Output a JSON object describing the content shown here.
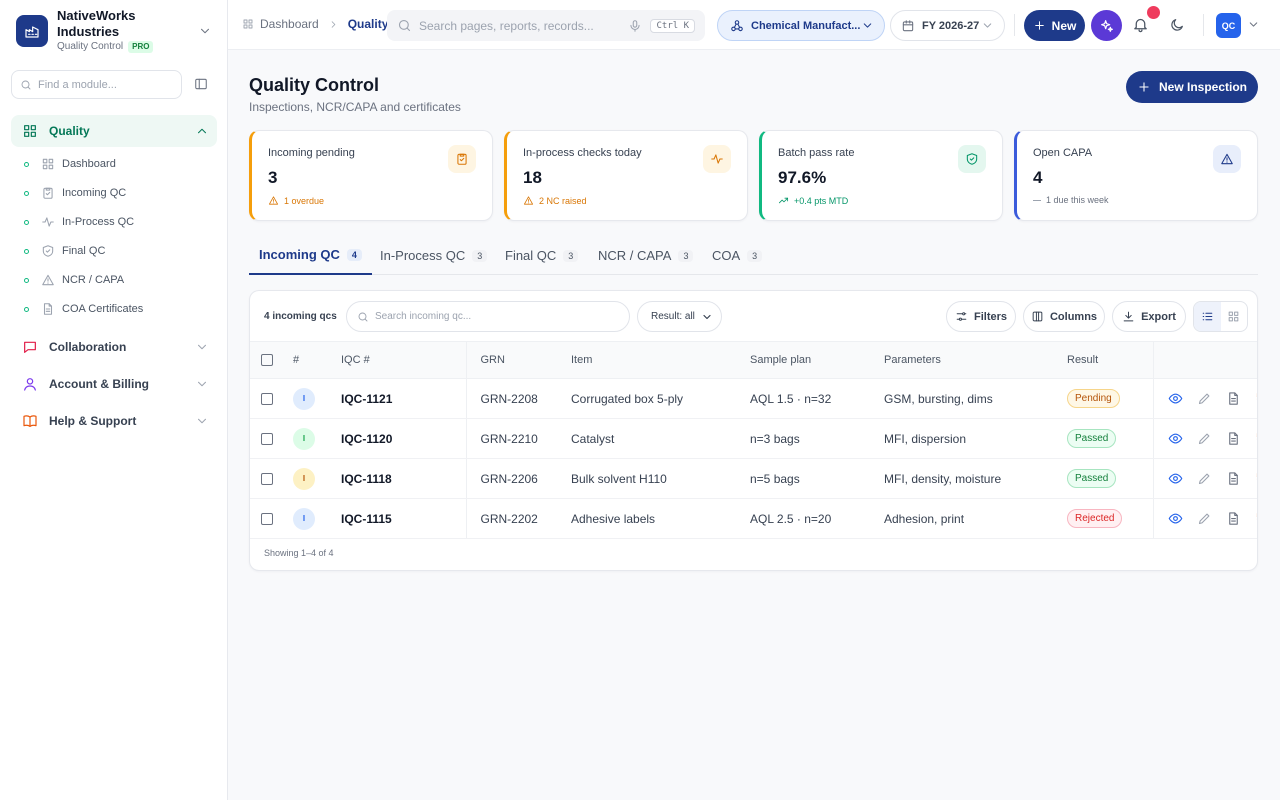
{
  "org": {
    "name": "NativeWorks Industries",
    "module": "Quality Control",
    "badge": "PRO"
  },
  "sidebar": {
    "search_placeholder": "Find a module...",
    "groups": {
      "quality": "Quality",
      "collaboration": "Collaboration",
      "account": "Account & Billing",
      "help": "Help & Support"
    },
    "quality_items": [
      "Dashboard",
      "Incoming QC",
      "In-Process QC",
      "Final QC",
      "NCR / CAPA",
      "COA Certificates"
    ]
  },
  "header": {
    "breadcrumb": [
      "Dashboard",
      "Quality"
    ],
    "search_placeholder": "Search pages, reports, records...",
    "shortcut": "Ctrl K",
    "org_selector": "Chemical Manufact...",
    "fiscal_year": "FY 2026-27",
    "new_label": "New",
    "avatar": "QC"
  },
  "page": {
    "title": "Quality Control",
    "subtitle": "Inspections, NCR/CAPA and certificates",
    "primary_action": "New Inspection"
  },
  "kpis": [
    {
      "label": "Incoming pending",
      "value": "3",
      "note": "1 overdue",
      "color": "#d97706"
    },
    {
      "label": "In-process checks today",
      "value": "18",
      "note": "2 NC raised",
      "color": "#d97706"
    },
    {
      "label": "Batch pass rate",
      "value": "97.6%",
      "note": "+0.4 pts MTD",
      "color": "#059669"
    },
    {
      "label": "Open CAPA",
      "value": "4",
      "note": "1 due this week",
      "color": "#6b7280"
    }
  ],
  "tabs": [
    {
      "label": "Incoming QC",
      "count": "4"
    },
    {
      "label": "In-Process QC",
      "count": "3"
    },
    {
      "label": "Final QC",
      "count": "3"
    },
    {
      "label": "NCR / CAPA",
      "count": "3"
    },
    {
      "label": "COA",
      "count": "3"
    }
  ],
  "table": {
    "count_label": "4 incoming qcs",
    "search_placeholder": "Search incoming qc...",
    "result_filter": "Result: all",
    "buttons": {
      "filters": "Filters",
      "columns": "Columns",
      "export": "Export"
    },
    "columns": [
      "#",
      "IQC #",
      "GRN",
      "Item",
      "Sample plan",
      "Parameters",
      "Result"
    ],
    "rows": [
      {
        "idx": "I",
        "iqc": "IQC-1121",
        "grn": "GRN-2208",
        "item": "Corrugated box 5-ply",
        "plan": "AQL 1.5 · n=32",
        "params": "GSM, bursting, dims",
        "result": "Pending"
      },
      {
        "idx": "I",
        "iqc": "IQC-1120",
        "grn": "GRN-2210",
        "item": "Catalyst",
        "plan": "n=3 bags",
        "params": "MFI, dispersion",
        "result": "Passed"
      },
      {
        "idx": "I",
        "iqc": "IQC-1118",
        "grn": "GRN-2206",
        "item": "Bulk solvent H110",
        "plan": "n=5 bags",
        "params": "MFI, density, moisture",
        "result": "Passed"
      },
      {
        "idx": "I",
        "iqc": "IQC-1115",
        "grn": "GRN-2202",
        "item": "Adhesive labels",
        "plan": "AQL 2.5 · n=20",
        "params": "Adhesion, print",
        "result": "Rejected"
      }
    ],
    "footer": "Showing 1–4 of 4"
  }
}
